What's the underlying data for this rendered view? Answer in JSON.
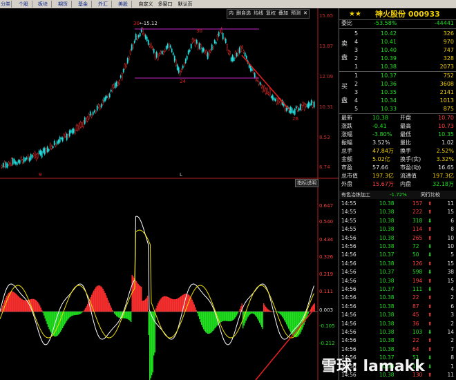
{
  "topbar": {
    "tabs": [
      "分类",
      "个股",
      "板块",
      "期货",
      "基金",
      "外汇",
      "美股"
    ],
    "tabs2": [
      "自定义",
      "多窗口",
      "默认页"
    ]
  },
  "chart_toolbar": [
    "内",
    "删自选",
    "均线",
    "复权",
    "叠加",
    "预测"
  ],
  "price_axis": [
    "15.65",
    "13.87",
    "12.09",
    "10.31",
    "8.53",
    "6.74"
  ],
  "annotations": {
    "high": "15.12",
    "n1": "30",
    "n2": "30",
    "n3": "24",
    "n4": "26"
  },
  "date_markers": [
    "9",
    "L"
  ],
  "indicator_btn": "指标说明",
  "macd_axis": [
    "0.647",
    "0.540",
    "0.434",
    "0.326",
    "0.219",
    "0.111",
    "0.003",
    "-0.105",
    "-0.212"
  ],
  "stock": {
    "name": "神火股份",
    "code": "000933"
  },
  "weibi": {
    "label": "委比",
    "pct": "-53.58%",
    "num": "-44441"
  },
  "sell_label": [
    "卖",
    "盘"
  ],
  "buy_label": [
    "买",
    "盘"
  ],
  "asks": [
    {
      "lv": "5",
      "price": "10.42",
      "vol": "326"
    },
    {
      "lv": "4",
      "price": "10.41",
      "vol": "970"
    },
    {
      "lv": "3",
      "price": "10.40",
      "vol": "747"
    },
    {
      "lv": "2",
      "price": "10.39",
      "vol": "328"
    },
    {
      "lv": "1",
      "price": "10.38",
      "vol": "2073"
    }
  ],
  "bids": [
    {
      "lv": "1",
      "price": "10.37",
      "vol": "752"
    },
    {
      "lv": "2",
      "price": "10.36",
      "vol": "3608"
    },
    {
      "lv": "3",
      "price": "10.35",
      "vol": "2141"
    },
    {
      "lv": "4",
      "price": "10.34",
      "vol": "1013"
    },
    {
      "lv": "5",
      "price": "10.33",
      "vol": "875"
    }
  ],
  "stats": [
    {
      "l1": "最新",
      "v1": "10.38",
      "c1": "g",
      "l2": "开盘",
      "v2": "10.70",
      "c2": "r"
    },
    {
      "l1": "涨跌",
      "v1": "-0.41",
      "c1": "g",
      "l2": "最高",
      "v2": "10.73",
      "c2": "r"
    },
    {
      "l1": "涨幅",
      "v1": "-3.80%",
      "c1": "g",
      "l2": "最低",
      "v2": "10.35",
      "c2": "g"
    },
    {
      "l1": "振幅",
      "v1": "3.52%",
      "c1": "w",
      "l2": "量比",
      "v2": "1.02",
      "c2": "w"
    },
    {
      "l1": "总手",
      "v1": "47.84万",
      "c1": "y",
      "l2": "换手",
      "v2": "2.52%",
      "c2": "y"
    },
    {
      "l1": "金额",
      "v1": "5.02亿",
      "c1": "y",
      "l2": "换手(实)",
      "v2": "3.32%",
      "c2": "y"
    },
    {
      "l1": "市盈",
      "v1": "57.66",
      "c1": "w",
      "l2": "市盈(动)",
      "v2": "16.65",
      "c2": "w"
    },
    {
      "l1": "总市值",
      "v1": "197.3亿",
      "c1": "y",
      "l2": "流通值",
      "v2": "197.3亿",
      "c2": "y"
    },
    {
      "l1": "外盘",
      "v1": "15.67万",
      "c1": "r",
      "l2": "内盘",
      "v2": "32.18万",
      "c2": "g"
    }
  ],
  "industry": {
    "name": "有色冶炼加工",
    "pct": "-1.72%",
    "link": "同行比较"
  },
  "ticks": [
    {
      "t": "14:55",
      "p": "10.38",
      "v": "157",
      "d": "dn",
      "n": "11"
    },
    {
      "t": "14:55",
      "p": "10.38",
      "v": "222",
      "d": "dn",
      "n": "15"
    },
    {
      "t": "14:55",
      "p": "10.38",
      "v": "318",
      "d": "up",
      "n": "6"
    },
    {
      "t": "14:55",
      "p": "10.38",
      "v": "114",
      "d": "dn",
      "n": "8"
    },
    {
      "t": "14:56",
      "p": "10.38",
      "v": "265",
      "d": "dn",
      "n": "10"
    },
    {
      "t": "14:56",
      "p": "10.38",
      "v": "72",
      "d": "up",
      "n": "10"
    },
    {
      "t": "14:56",
      "p": "10.37",
      "v": "50",
      "d": "up",
      "n": "5"
    },
    {
      "t": "14:56",
      "p": "10.38",
      "v": "126",
      "d": "dn",
      "n": "15"
    },
    {
      "t": "14:56",
      "p": "10.37",
      "v": "598",
      "d": "up",
      "n": "38"
    },
    {
      "t": "14:56",
      "p": "10.38",
      "v": "194",
      "d": "dn",
      "n": "15"
    },
    {
      "t": "14:56",
      "p": "10.37",
      "v": "111",
      "d": "up",
      "n": "4"
    },
    {
      "t": "14:56",
      "p": "10.38",
      "v": "22",
      "d": "dn",
      "n": "2"
    },
    {
      "t": "14:56",
      "p": "10.38",
      "v": "87",
      "d": "dn",
      "n": "6"
    },
    {
      "t": "14:56",
      "p": "10.38",
      "v": "45",
      "d": "dn",
      "n": "3"
    },
    {
      "t": "14:56",
      "p": "10.38",
      "v": "36",
      "d": "dn",
      "n": "2"
    },
    {
      "t": "14:56",
      "p": "10.38",
      "v": "103",
      "d": "up",
      "n": "14"
    },
    {
      "t": "14:56",
      "p": "10.38",
      "v": "22",
      "d": "dn",
      "n": "2"
    },
    {
      "t": "14:56",
      "p": "10.38",
      "v": "64",
      "d": "dn",
      "n": "7"
    },
    {
      "t": "14:56",
      "p": "10.37",
      "v": "51",
      "d": "up",
      "n": "8"
    },
    {
      "t": "14:56",
      "p": "10.38",
      "v": "10",
      "d": "up",
      "n": "1"
    },
    {
      "t": "14:56",
      "p": "10.38",
      "v": "130",
      "d": "dn",
      "n": "11"
    }
  ],
  "watermark": "雪球: lamakk",
  "colors": {
    "up": "#ff3030",
    "down": "#20e020",
    "accent": "#f0d000",
    "ma_line": "#a020a0"
  }
}
